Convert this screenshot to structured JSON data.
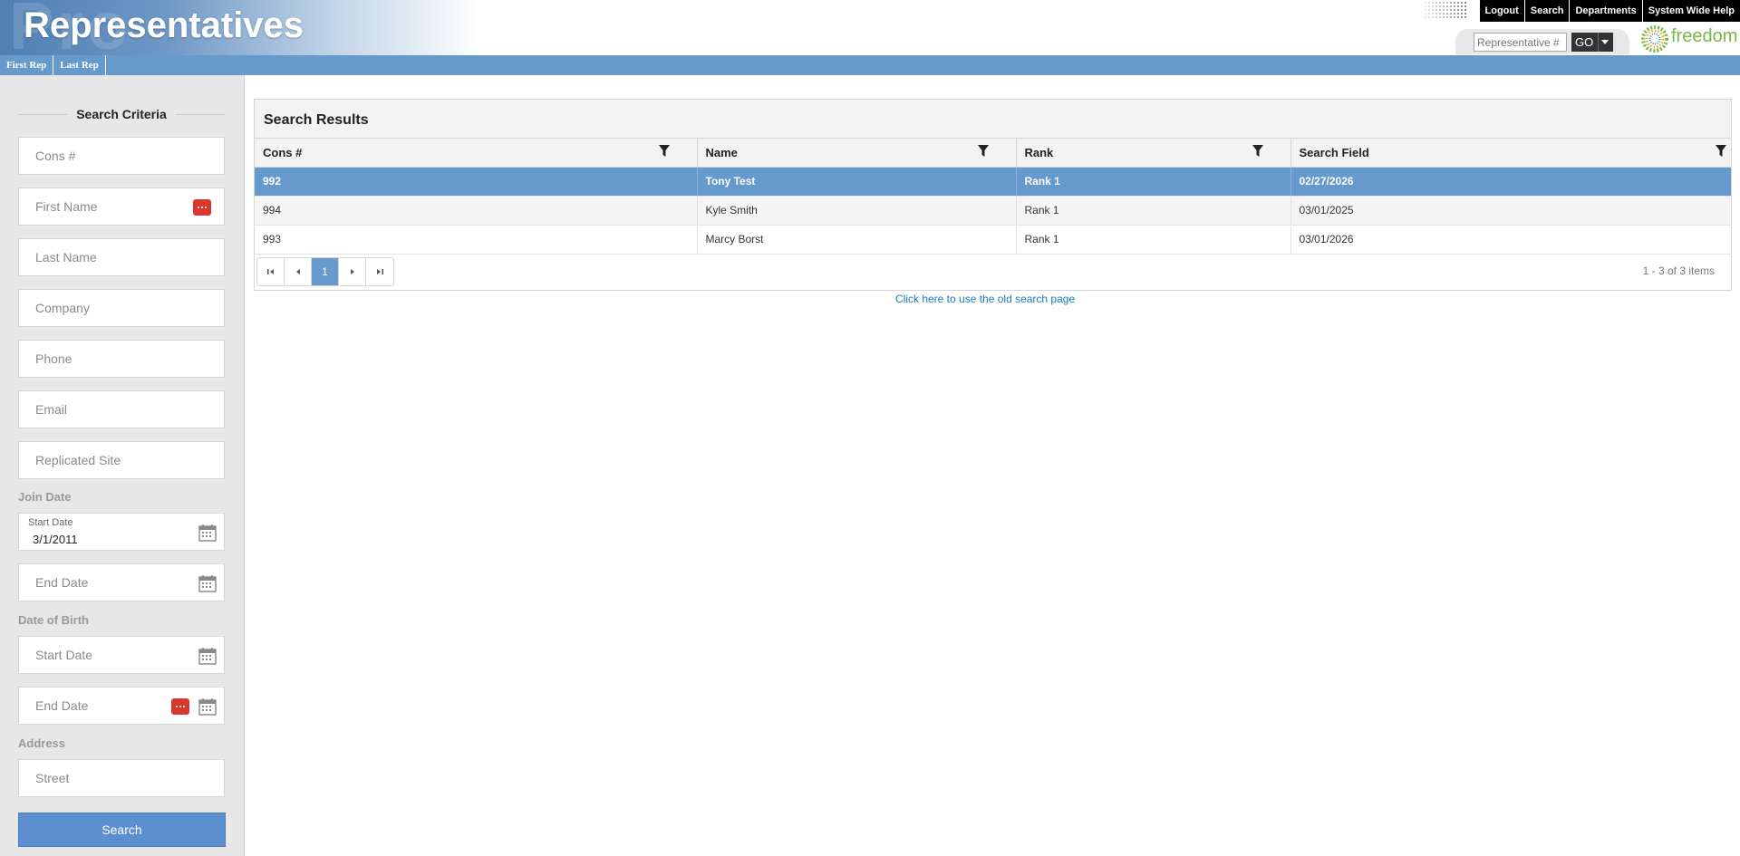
{
  "header": {
    "title": "Representatives",
    "top_links": [
      "Logout",
      "Search",
      "Departments",
      "System Wide Help"
    ],
    "quick_search": {
      "placeholder": "Representative #",
      "go_label": "GO"
    },
    "logo_text": "freedom"
  },
  "nav": {
    "items": [
      "First Rep",
      "Last Rep"
    ]
  },
  "sidebar": {
    "heading": "Search Criteria",
    "fields": {
      "cons": "Cons #",
      "first_name": "First Name",
      "last_name": "Last Name",
      "company": "Company",
      "phone": "Phone",
      "email": "Email",
      "replicated_site": "Replicated Site"
    },
    "join_date": {
      "label": "Join Date",
      "start_label": "Start Date",
      "start_value": "3/1/2011",
      "end_placeholder": "End Date"
    },
    "dob": {
      "label": "Date of Birth",
      "start_placeholder": "Start Date",
      "end_placeholder": "End Date"
    },
    "address": {
      "label": "Address",
      "street_placeholder": "Street"
    },
    "search_button": "Search"
  },
  "results": {
    "title": "Search Results",
    "columns": [
      "Cons #",
      "Name",
      "Rank",
      "Search Field"
    ],
    "rows": [
      {
        "cons": "992",
        "name": "Tony Test",
        "rank": "Rank 1",
        "search_field": "02/27/2026"
      },
      {
        "cons": "994",
        "name": "Kyle Smith",
        "rank": "Rank 1",
        "search_field": "03/01/2025"
      },
      {
        "cons": "993",
        "name": "Marcy Borst",
        "rank": "Rank 1",
        "search_field": "03/01/2026"
      }
    ],
    "pager": {
      "current_page": "1",
      "info": "1 - 3 of 3 items"
    },
    "old_search_link": "Click here to use the old search page"
  },
  "colors": {
    "accent": "#6699cc",
    "button": "#5b8fd0",
    "alert_icon": "#d9382f",
    "logo": "#7ab648"
  }
}
